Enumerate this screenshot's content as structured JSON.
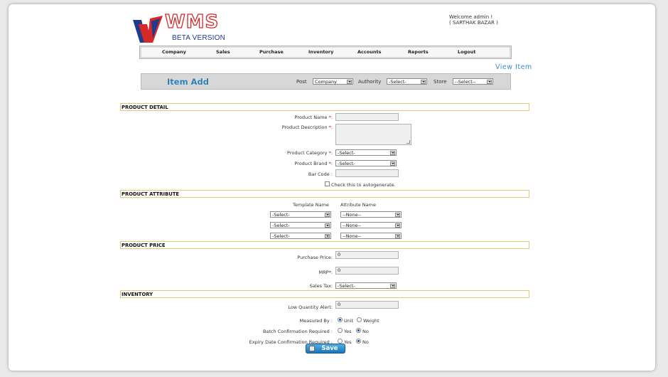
{
  "header": {
    "logo_text": "WMS",
    "logo_subtitle": "BETA VERSION",
    "welcome": "Welcome admin !",
    "store_name": "( SARTHAK BAZAR )"
  },
  "nav": {
    "items": [
      "Company",
      "Sales",
      "Purchase",
      "Inventory",
      "Accounts",
      "Reports",
      "Logout"
    ]
  },
  "view_item_link": "View Item",
  "item_bar": {
    "title": "Item Add",
    "post_label": "Post",
    "post_value": "Company",
    "authority_label": "Authority",
    "authority_value": "-Select-",
    "store_label": "Store",
    "store_value": "--Select--"
  },
  "product_detail": {
    "heading": "PRODUCT DETAIL",
    "name_label": "Product Name ",
    "description_label": "Product Description ",
    "category_label": "Product Category ",
    "category_value": "-Select-",
    "brand_label": "Product Brand ",
    "brand_value": "-Select-",
    "barcode_label": "Bar Code ",
    "autogenerate_label": "Check this to autogenerate.",
    "required_mark": "*",
    "colon": ":"
  },
  "product_attribute": {
    "heading": "PRODUCT ATTRIBUTE",
    "template_header": "Template Name",
    "attribute_header": "Attribute Name",
    "rows": [
      {
        "template": "-Select-",
        "attribute": "--None--"
      },
      {
        "template": "-Select-",
        "attribute": "--None--"
      },
      {
        "template": "-Select-",
        "attribute": "--None--"
      }
    ]
  },
  "product_price": {
    "heading": "PRODUCT PRICE",
    "purchase_label": "Purchase Price:",
    "purchase_value": "0",
    "mrp_label": "MRP*:",
    "mrp_value": "0",
    "sales_tax_label": "Sales Tax:",
    "sales_tax_value": "-Select-"
  },
  "inventory": {
    "heading": "INVENTORY",
    "low_qty_label": "Low Quantity Alert:",
    "low_qty_value": "0",
    "measured_label": "Measured By :",
    "unit_label": "Unit",
    "weight_label": "Weight",
    "batch_label": "Batch Confirmation Required :",
    "expiry_label": "Expiry Date Confirmation Required :",
    "yes_label": "Yes",
    "no_label": "No"
  },
  "save_label": "Save",
  "colors": {
    "accent": "#2a7fb8",
    "section_border": "#e2c97c",
    "required": "#dd0000",
    "logo_red": "#d42a2a",
    "logo_blue": "#1f3a8f"
  }
}
